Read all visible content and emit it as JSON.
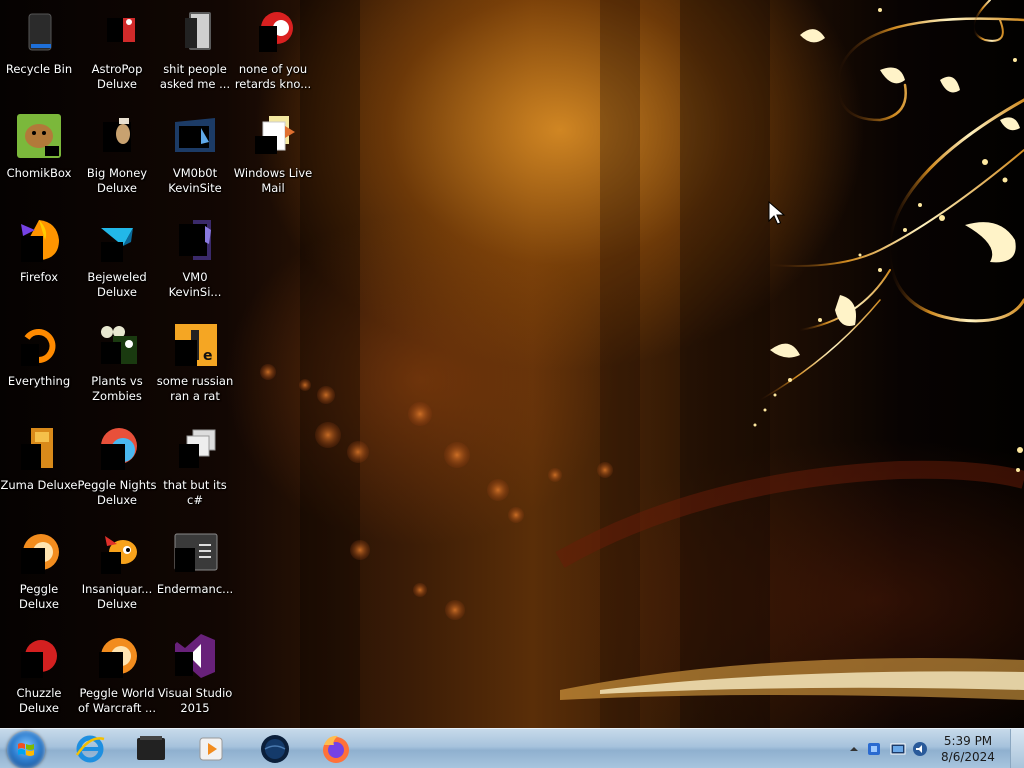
{
  "desktop": {
    "icons": [
      {
        "id": "recycle-bin",
        "label": "Recycle Bin"
      },
      {
        "id": "astropop-deluxe",
        "label": "AstroPop\nDeluxe"
      },
      {
        "id": "shit-people",
        "label": "shit people\nasked me ..."
      },
      {
        "id": "none-of-you",
        "label": "none of you\nretards kno..."
      },
      {
        "id": "chomikbox",
        "label": "ChomikBox"
      },
      {
        "id": "big-money-deluxe",
        "label": "Big Money\nDeluxe"
      },
      {
        "id": "vm0b0t-kevinsite",
        "label": "VM0b0t\nKevinSite"
      },
      {
        "id": "windows-live-mail",
        "label": "Windows Live\nMail"
      },
      {
        "id": "firefox",
        "label": "Firefox"
      },
      {
        "id": "bejeweled-deluxe",
        "label": "Bejeweled\nDeluxe"
      },
      {
        "id": "vm0-kevinsite",
        "label": "VM0\nKevinSi..."
      },
      {
        "id": "everything",
        "label": "Everything"
      },
      {
        "id": "plants-vs-zombies",
        "label": "Plants vs\nZombies"
      },
      {
        "id": "some-russian",
        "label": "some russian\nran a rat"
      },
      {
        "id": "zuma-deluxe",
        "label": "Zuma Deluxe"
      },
      {
        "id": "peggle-nights",
        "label": "Peggle Nights\nDeluxe"
      },
      {
        "id": "that-but-its-c",
        "label": "that but its c#"
      },
      {
        "id": "peggle-deluxe",
        "label": "Peggle Deluxe"
      },
      {
        "id": "insaniquarium",
        "label": "Insaniquar...\nDeluxe"
      },
      {
        "id": "endermanch",
        "label": "Endermanc..."
      },
      {
        "id": "chuzzle-deluxe",
        "label": "Chuzzle\nDeluxe"
      },
      {
        "id": "peggle-world-of-warcraft",
        "label": "Peggle World\nof Warcraft ..."
      },
      {
        "id": "visual-studio-2015",
        "label": "Visual Studio\n2015"
      }
    ]
  },
  "taskbar": {
    "pinned": [
      "internet-explorer-icon",
      "folder-icon",
      "media-player-icon",
      "globe-icon",
      "firefox-icon"
    ],
    "clock": {
      "time": "5:39 PM",
      "date": "8/6/2024"
    }
  },
  "colors": {
    "taskbar": "#a6c2dc",
    "accent_gold": "#f5c04a"
  }
}
